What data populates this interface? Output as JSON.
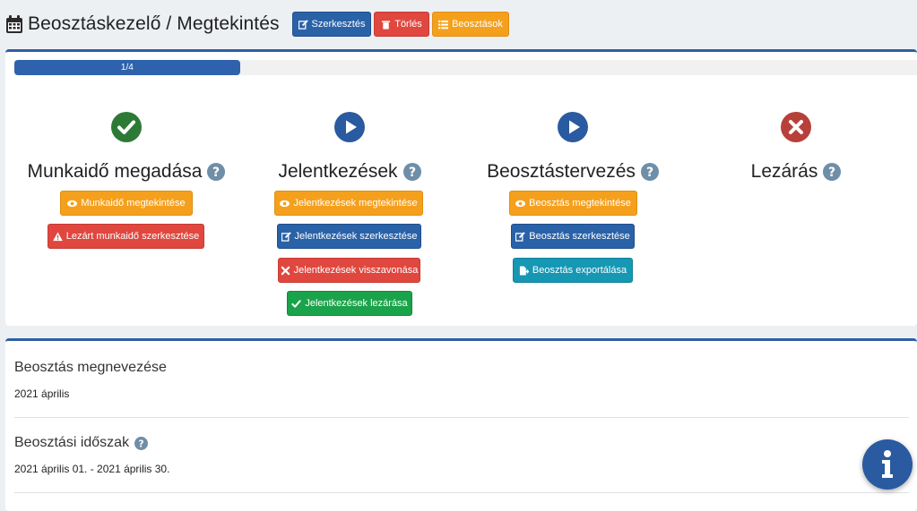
{
  "header": {
    "title": "Beosztáskezelő / Megtekintés",
    "edit_label": "Szerkesztés",
    "delete_label": "Törlés",
    "list_label": "Beosztások"
  },
  "progress": {
    "label": "1/4",
    "value": 0.25
  },
  "steps": [
    {
      "title": "Munkaidő megadása",
      "status": "done",
      "actions": [
        "Munkaidő megtekintése",
        "Lezárt munkaidő szerkesztése"
      ]
    },
    {
      "title": "Jelentkezések",
      "status": "active",
      "actions": [
        "Jelentkezések megtekintése",
        "Jelentkezések szerkesztése",
        "Jelentkezések visszavonása",
        "Jelentkezések lezárása"
      ]
    },
    {
      "title": "Beosztástervezés",
      "status": "active",
      "actions": [
        "Beosztás megtekintése",
        "Beosztás szerkesztése",
        "Beosztás exportálása"
      ]
    },
    {
      "title": "Lezárás",
      "status": "blocked",
      "actions": []
    }
  ],
  "details": {
    "name_label": "Beosztás megnevezése",
    "name_value": "2021 április",
    "period_label": "Beosztási időszak",
    "period_value": "2021 április 01. - 2021 április 30."
  },
  "colors": {
    "primary": "#2a62a8",
    "danger": "#e0473f",
    "warning": "#f5a01d",
    "success": "#1aa34a",
    "info": "#1697b3",
    "done": "#2d7a36",
    "blocked": "#b8403a"
  }
}
